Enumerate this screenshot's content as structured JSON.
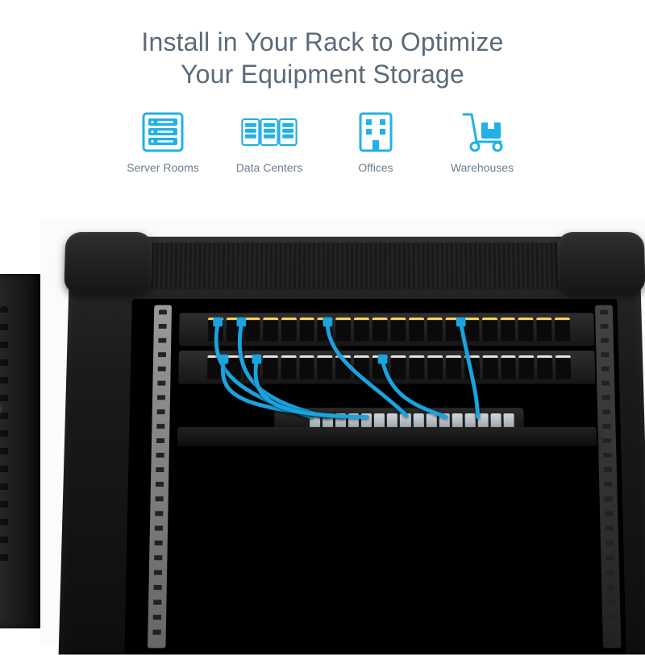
{
  "headline": {
    "line1": "Install in Your Rack to Optimize",
    "line2": "Your Equipment Storage"
  },
  "features": [
    {
      "id": "server-rooms",
      "label": "Server Rooms",
      "icon": "server-rack-icon"
    },
    {
      "id": "data-centers",
      "label": "Data Centers",
      "icon": "data-center-icon"
    },
    {
      "id": "offices",
      "label": "Offices",
      "icon": "office-building-icon"
    },
    {
      "id": "warehouses",
      "label": "Warehouses",
      "icon": "hand-truck-icon"
    }
  ],
  "colors": {
    "accent": "#21b1e6",
    "text_muted": "#5a6b7a",
    "cable": "#1aa4e0"
  }
}
